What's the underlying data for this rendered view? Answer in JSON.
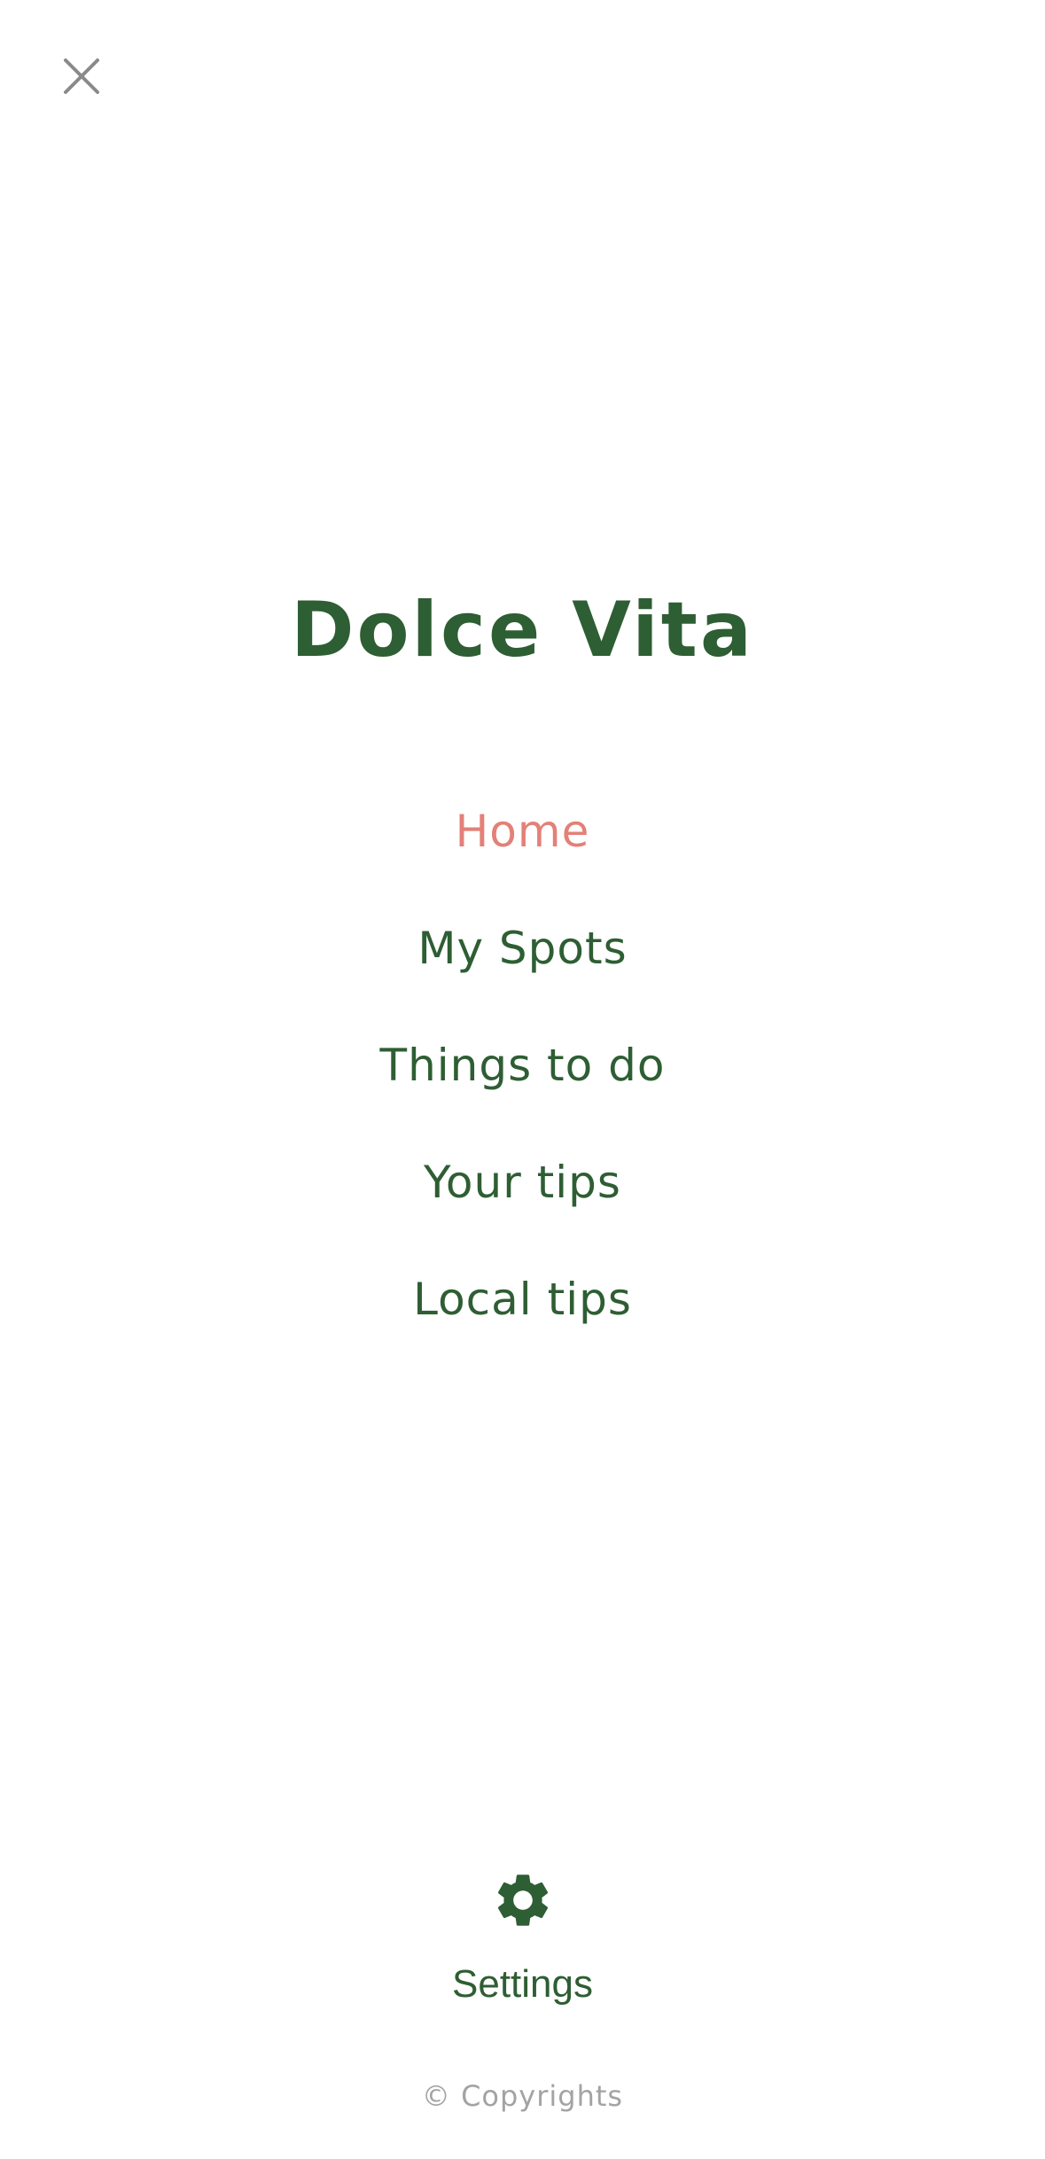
{
  "header": {
    "close_icon": "close-icon"
  },
  "brand": {
    "title": "Dolce Vita"
  },
  "nav": {
    "items": [
      {
        "label": "Home",
        "active": true
      },
      {
        "label": "My Spots",
        "active": false
      },
      {
        "label": "Things to do",
        "active": false
      },
      {
        "label": "Your tips",
        "active": false
      },
      {
        "label": "Local tips",
        "active": false
      }
    ]
  },
  "settings": {
    "icon": "gear-icon",
    "label": "Settings"
  },
  "footer": {
    "copyright": "© Copyrights"
  },
  "colors": {
    "brand_green": "#2e5e33",
    "active_pink": "#e38078",
    "muted_grey": "#a3a3a3",
    "background": "#ffffff"
  }
}
